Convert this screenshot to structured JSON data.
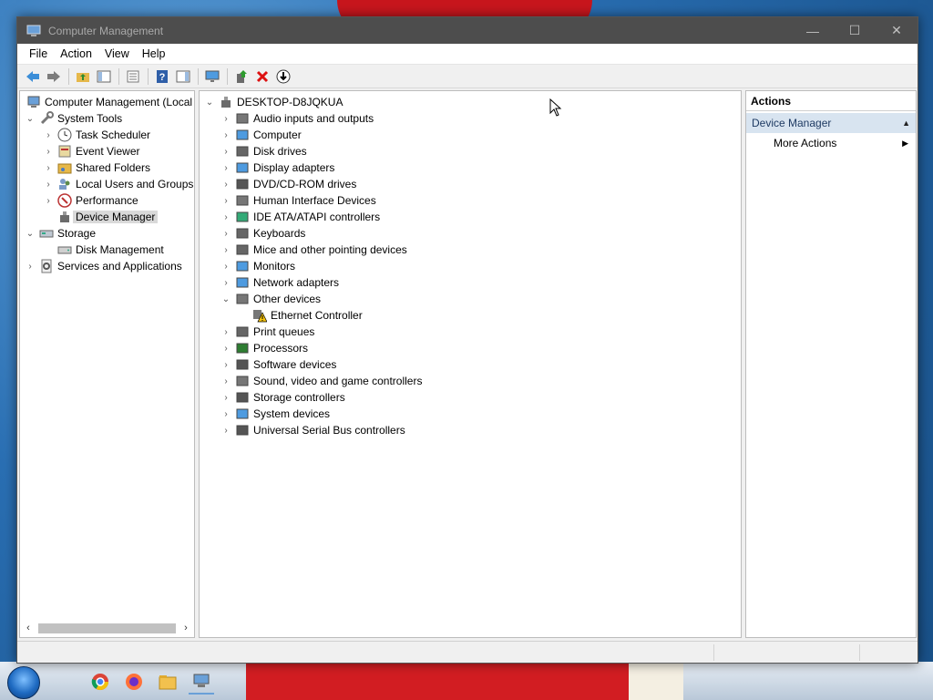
{
  "window": {
    "title": "Computer Management",
    "minimize_glyph": "—",
    "maximize_glyph": "☐",
    "close_glyph": "✕"
  },
  "menu": [
    "File",
    "Action",
    "View",
    "Help"
  ],
  "left_tree": {
    "root": "Computer Management (Local",
    "system_tools": "System Tools",
    "task_scheduler": "Task Scheduler",
    "event_viewer": "Event Viewer",
    "shared_folders": "Shared Folders",
    "local_users_groups": "Local Users and Groups",
    "performance": "Performance",
    "device_manager": "Device Manager",
    "storage": "Storage",
    "disk_management": "Disk Management",
    "services_apps": "Services and Applications"
  },
  "device_tree": {
    "root": "DESKTOP-D8JQKUA",
    "categories": [
      "Audio inputs and outputs",
      "Computer",
      "Disk drives",
      "Display adapters",
      "DVD/CD-ROM drives",
      "Human Interface Devices",
      "IDE ATA/ATAPI controllers",
      "Keyboards",
      "Mice and other pointing devices",
      "Monitors",
      "Network adapters",
      "Other devices",
      "Print queues",
      "Processors",
      "Software devices",
      "Sound, video and game controllers",
      "Storage controllers",
      "System devices",
      "Universal Serial Bus controllers"
    ],
    "other_devices_child": "Ethernet Controller"
  },
  "actions": {
    "header": "Actions",
    "section": "Device Manager",
    "more_actions": "More Actions"
  },
  "colors": {
    "titlebar": "#4d4d4d",
    "selection": "#d9d9d9",
    "actions_section": "#d8e4f0"
  }
}
